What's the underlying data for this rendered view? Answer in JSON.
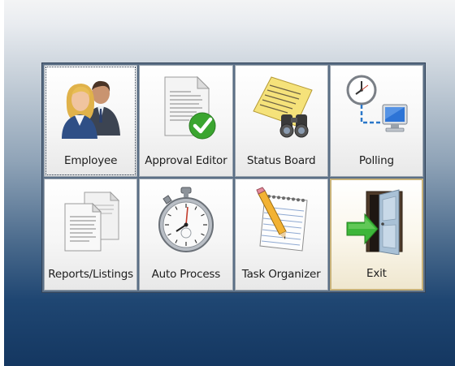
{
  "menu": {
    "tiles": [
      {
        "label": "Employee",
        "icon": "employee-people-icon"
      },
      {
        "label": "Approval Editor",
        "icon": "document-approved-icon"
      },
      {
        "label": "Status Board",
        "icon": "status-board-binoculars-icon"
      },
      {
        "label": "Polling",
        "icon": "clock-network-monitor-icon"
      },
      {
        "label": "Reports/Listings",
        "icon": "reports-documents-icon"
      },
      {
        "label": "Auto Process",
        "icon": "stopwatch-icon"
      },
      {
        "label": "Task Organizer",
        "icon": "notepad-pencil-icon"
      },
      {
        "label": "Exit",
        "icon": "exit-door-icon"
      }
    ]
  },
  "colors": {
    "background_top": "#f3f4f5",
    "background_bottom": "#143761",
    "tile_selected_border": "#c9b37a",
    "check_green": "#3aa52f"
  }
}
